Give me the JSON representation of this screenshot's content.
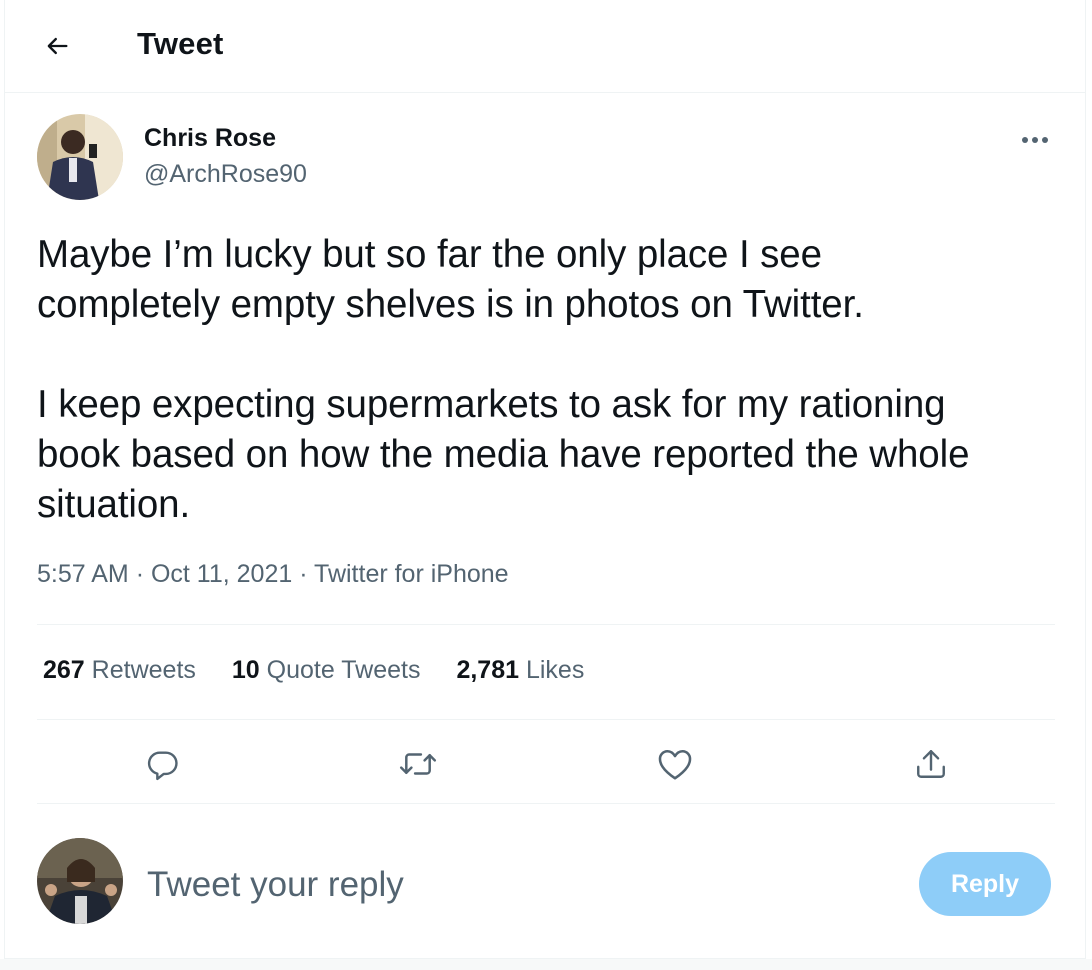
{
  "header": {
    "back_icon": "arrow-left-icon",
    "title": "Tweet"
  },
  "author": {
    "name": "Chris Rose",
    "handle": "@ArchRose90",
    "more_icon": "more-horizontal-icon"
  },
  "tweet": {
    "text": "Maybe I’m lucky but so far the only place I see\ncompletely empty shelves is in photos on Twitter.\n\nI keep expecting supermarkets to ask for my rationing\nbook based on how the media have reported the whole\nsituation.",
    "time": "5:57 AM",
    "date": "Oct 11, 2021",
    "source": "Twitter for iPhone",
    "separator": "·"
  },
  "stats": {
    "retweets_count": "267",
    "retweets_label": "Retweets",
    "quotes_count": "10",
    "quotes_label": "Quote Tweets",
    "likes_count": "2,781",
    "likes_label": "Likes"
  },
  "actions": {
    "reply_icon": "reply-icon",
    "retweet_icon": "retweet-icon",
    "like_icon": "heart-icon",
    "share_icon": "share-icon"
  },
  "composer": {
    "placeholder": "Tweet your reply",
    "value": "",
    "button_label": "Reply"
  },
  "colors": {
    "text_primary": "#0f1419",
    "text_secondary": "#536471",
    "reply_button_disabled": "#8ecdf8",
    "icon": "#536471"
  }
}
